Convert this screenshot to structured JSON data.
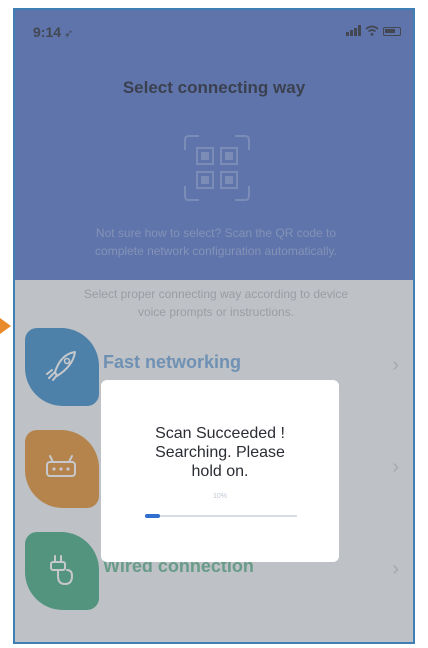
{
  "status_bar": {
    "time": "9:14"
  },
  "header": {
    "title": "Select connecting way",
    "hint_line1": "Not sure how to select? Scan the QR code to",
    "hint_line2": "complete network configuration automatically."
  },
  "sub_hint": {
    "line1": "Select proper connecting way according to device",
    "line2": "voice prompts or instructions."
  },
  "options": [
    {
      "label": "Fast networking",
      "color": "#2f86c6",
      "label_color": "#6aa0d8",
      "icon": "rocket-icon"
    },
    {
      "label": "",
      "color": "#e08a25",
      "label_color": "#d0852c",
      "icon": "router-icon"
    },
    {
      "label": "Wired connection",
      "color": "#3aa57a",
      "label_color": "#5fb28e",
      "icon": "cable-icon"
    }
  ],
  "dialog": {
    "line1": "Scan Succeeded !",
    "line2": "Searching. Please",
    "line3": "hold on.",
    "progress_text": "10%",
    "progress": 0.1
  },
  "colors": {
    "header_blue": "#4c6fc6",
    "accent_orange": "#e98a2b",
    "progress_blue": "#2f6fcf"
  }
}
